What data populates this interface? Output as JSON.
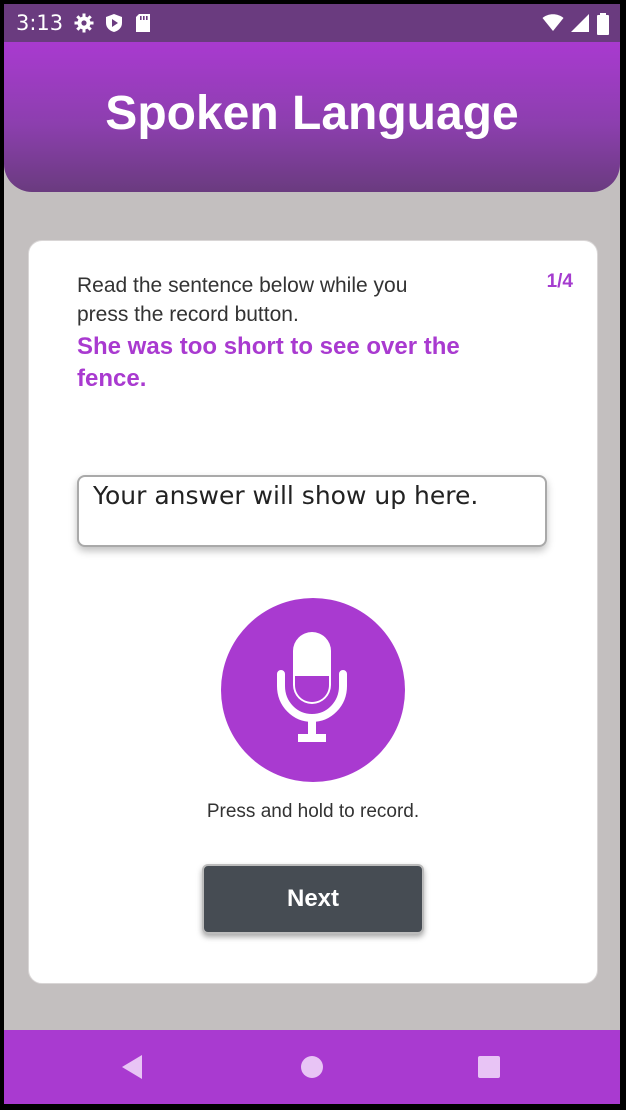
{
  "status_bar": {
    "time": "3:13",
    "left_icons": [
      "gear-icon",
      "shield-play-icon",
      "sd-card-icon"
    ],
    "right_icons": [
      "wifi-icon",
      "signal-icon",
      "battery-icon"
    ]
  },
  "header": {
    "title": "Spoken Language"
  },
  "card": {
    "instruction": "Read the sentence below while you press the record button.",
    "progress": "1/4",
    "sentence": "She was too short to see over the fence.",
    "answer_placeholder": "Your answer will show up here.",
    "mic_icon": "microphone-icon",
    "record_hint": "Press and hold to record.",
    "next_label": "Next"
  },
  "nav_bar": {
    "icons": [
      "back-icon",
      "home-icon",
      "recents-icon"
    ]
  },
  "colors": {
    "accent": "#a93ad0",
    "header_dark": "#6a3b7f",
    "button_dark": "#464c53",
    "background": "#c3bfbf"
  }
}
